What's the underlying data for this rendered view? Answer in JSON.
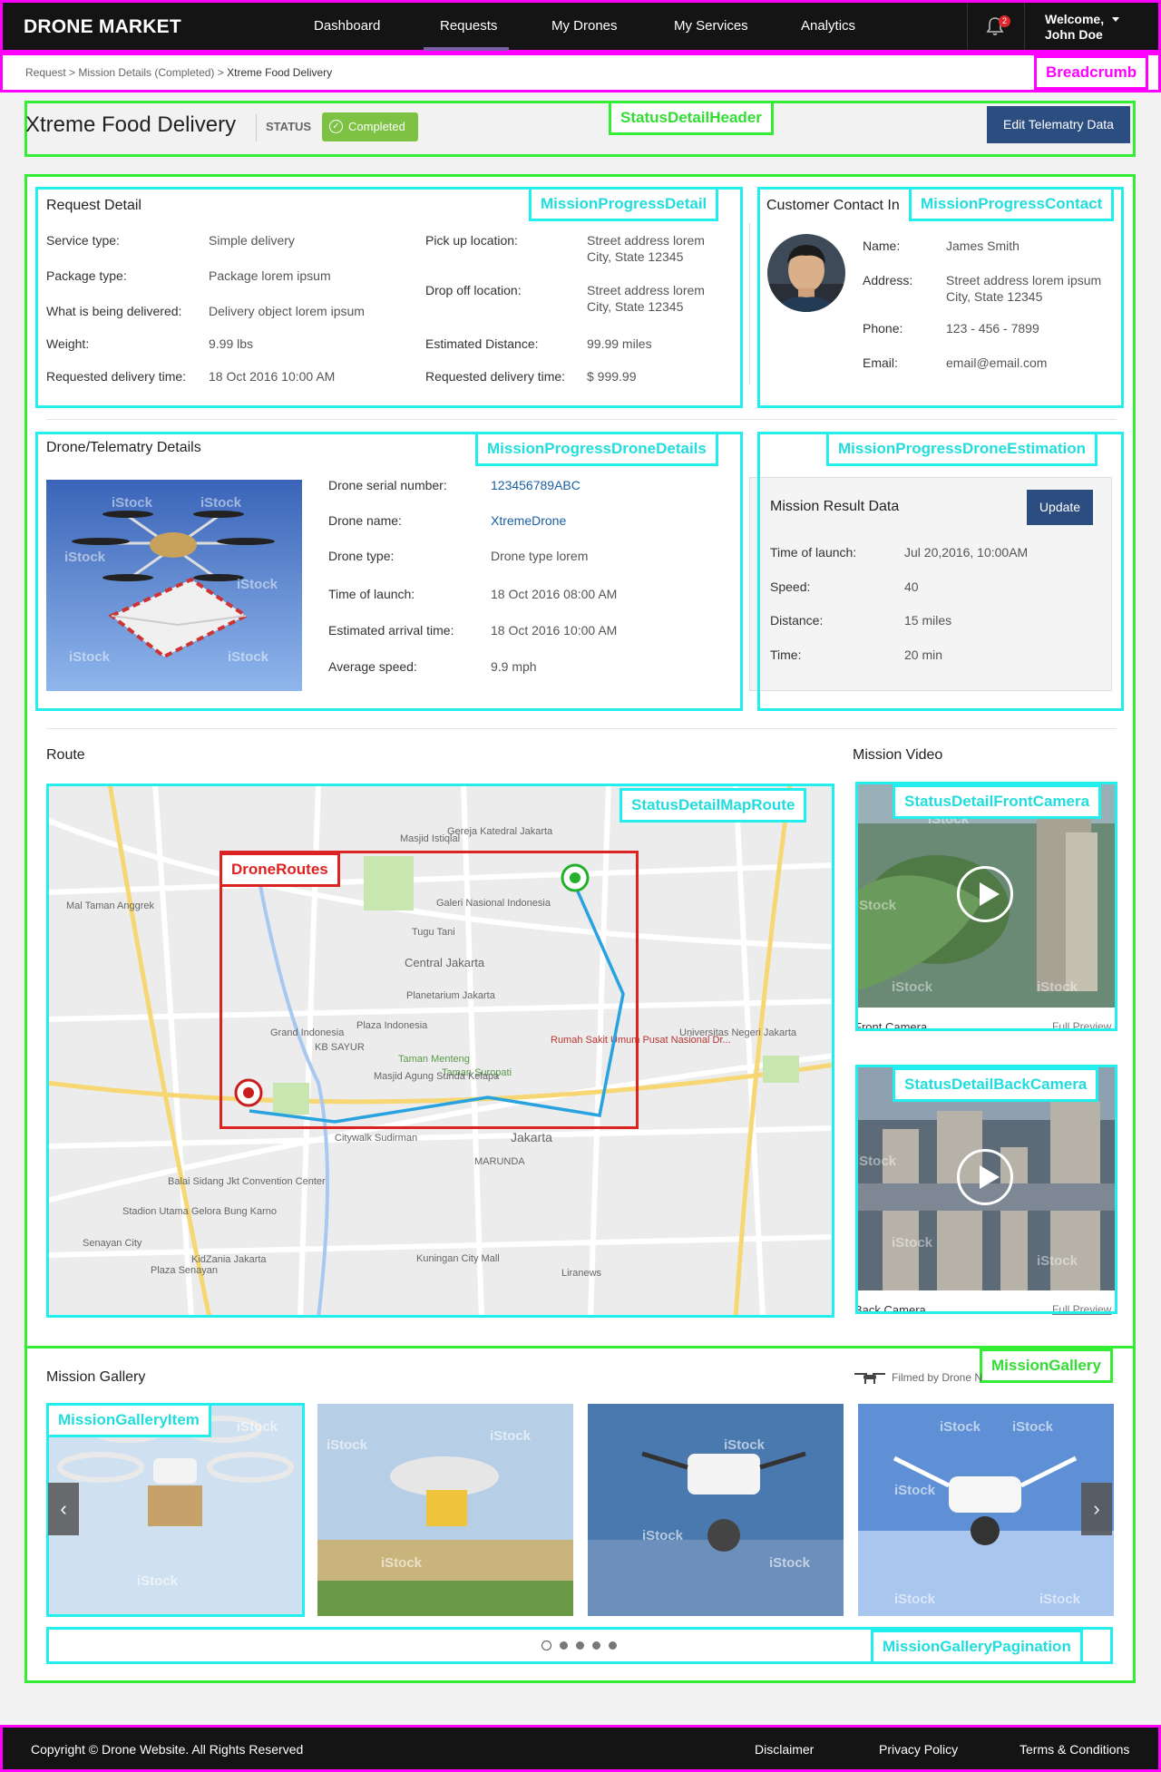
{
  "brand": {
    "logo": "DRONE MARKET"
  },
  "nav": {
    "items": [
      {
        "label": "Dashboard"
      },
      {
        "label": "Requests"
      },
      {
        "label": "My Drones"
      },
      {
        "label": "My Services"
      },
      {
        "label": "Analytics"
      }
    ],
    "active": "Requests",
    "notification_count": "2",
    "welcome_line1": "Welcome,",
    "welcome_line2": "John Doe"
  },
  "breadcrumb": {
    "part1": "Request > Mission Details (Completed)  >",
    "current": "Xtreme Food Delivery"
  },
  "annotations": {
    "breadcrumb": "Breadcrumb",
    "status_header": "StatusDetailHeader",
    "progress_detail": "MissionProgressDetail",
    "progress_contact": "MissionProgressContact",
    "drone_details": "MissionProgressDroneDetails",
    "drone_estimation": "MissionProgressDroneEstimation",
    "map_route": "StatusDetailMapRoute",
    "drone_routes": "DroneRoutes",
    "front_camera": "StatusDetailFrontCamera",
    "back_camera": "StatusDetailBackCamera",
    "gallery": "MissionGallery",
    "gallery_item": "MissionGalleryItem",
    "gallery_pagination": "MissionGalleryPagination"
  },
  "header": {
    "title": "Xtreme Food Delivery",
    "status_label": "STATUS",
    "status_value": "Completed",
    "edit_button": "Edit Telematry Data"
  },
  "request_detail": {
    "title": "Request Detail",
    "left": [
      {
        "label": "Service type:",
        "value": "Simple delivery"
      },
      {
        "label": "Package type:",
        "value": "Package lorem ipsum"
      },
      {
        "label": "What is being delivered:",
        "value": "Delivery object lorem ipsum"
      },
      {
        "label": "Weight:",
        "value": "9.99 lbs"
      },
      {
        "label": "Requested delivery time:",
        "value": "18 Oct 2016  10:00 AM"
      }
    ],
    "right": [
      {
        "label": "Pick up location:",
        "value1": "Street address lorem",
        "value2": "City, State 12345"
      },
      {
        "label": "Drop off location:",
        "value1": "Street address lorem",
        "value2": "City, State 12345"
      },
      {
        "label": "Estimated Distance:",
        "value1": "99.99 miles"
      },
      {
        "label": "Requested delivery time:",
        "value1": "$ 999.99"
      }
    ]
  },
  "contact": {
    "title": "Customer Contact In",
    "name_label": "Name:",
    "name": "James Smith",
    "address_label": "Address:",
    "address1": "Street address lorem ipsum",
    "address2": "City, State 12345",
    "phone_label": "Phone:",
    "phone": "123 - 456 - 7899",
    "email_label": "Email:",
    "email": "email@email.com"
  },
  "drone": {
    "title": "Drone/Telematry Details",
    "fields": [
      {
        "label": "Drone serial number:",
        "value": "123456789ABC"
      },
      {
        "label": "Drone name:",
        "value": "XtremeDrone"
      },
      {
        "label": "Drone type:",
        "value": "Drone type lorem"
      },
      {
        "label": "Time of launch:",
        "value": "18 Oct 2016  08:00 AM"
      },
      {
        "label": "Estimated arrival time:",
        "value": "18 Oct 2016  10:00 AM"
      },
      {
        "label": "Average speed:",
        "value": "9.9 mph"
      }
    ],
    "watermark": "iStock"
  },
  "result": {
    "title": "Mission Result Data",
    "update_button": "Update",
    "fields": [
      {
        "label": "Time of launch:",
        "value": "Jul 20,2016, 10:00AM"
      },
      {
        "label": "Speed:",
        "value": "40"
      },
      {
        "label": "Distance:",
        "value": "15 miles"
      },
      {
        "label": "Time:",
        "value": "20 min"
      }
    ]
  },
  "route": {
    "title": "Route",
    "map_labels": [
      "Central Jakarta",
      "Jakarta",
      "Grand Indonesia",
      "Plaza Indonesia",
      "Planetarium Jakarta",
      "Tugu Tani",
      "Galeri Nasional Indonesia",
      "Masjid Istiqlal",
      "Gereja Katedral Jakarta",
      "Universitas Negeri Jakarta",
      "Citywalk Sudirman",
      "MARUNDA",
      "Balai Sidang Jkt Convention Center",
      "Stadion Utama Gelora Bung Karno",
      "KidZania Jakarta",
      "Kuningan City Mall",
      "Plaza Senayan",
      "Mal Taman Anggrek",
      "KB SAYUR",
      "Taman Menteng",
      "Taman Suropati",
      "Masjid Agung Sunda Kelapa",
      "Senayan City",
      "Liranews",
      "Rumah Sakit Umum Pusat Nasional Dr..."
    ]
  },
  "video": {
    "title": "Mission Video",
    "front_label": "Front Camera",
    "back_label": "Back Camera",
    "full_preview": "Full Preview"
  },
  "gallery": {
    "title": "Mission Gallery",
    "filmed_by": "Filmed by Drone N",
    "watermark": "iStock",
    "prev": "‹",
    "next": "›"
  },
  "footer": {
    "copyright": "Copyright © Drone Website. All Rights Reserved",
    "links": [
      "Disclaimer",
      "Privacy Policy",
      "Terms & Conditions"
    ]
  }
}
